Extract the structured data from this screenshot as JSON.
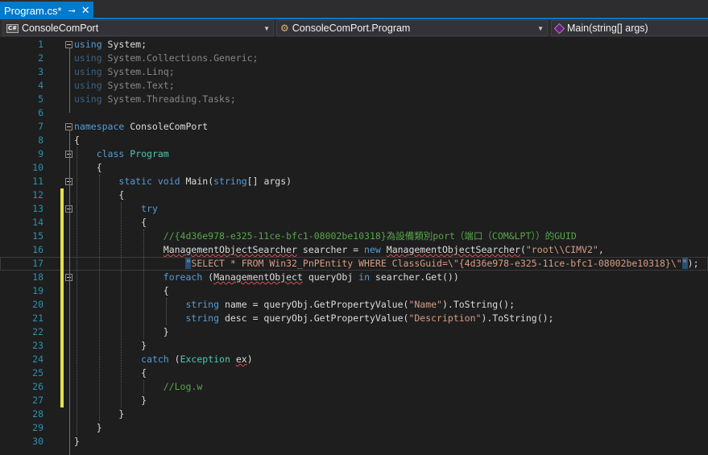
{
  "tab": {
    "title": "Program.cs*",
    "pin_icon": "pin-icon",
    "close_icon": "close-icon"
  },
  "navbar": {
    "project": "ConsoleComPort",
    "class_name": "ConsoleComPort.Program",
    "member": "Main(string[] args)"
  },
  "editor": {
    "colors": {
      "keyword": "#569cd6",
      "type": "#4ec9b0",
      "string": "#d69d85",
      "comment": "#57a64a",
      "line_number": "#2b91af",
      "changed": "#e5e04a"
    },
    "lines": [
      {
        "n": "1",
        "fold": true,
        "changed": false,
        "t": [
          [
            "kw",
            "using"
          ],
          [
            "txt",
            " System;"
          ]
        ]
      },
      {
        "n": "2",
        "fold": false,
        "changed": false,
        "t": [
          [
            "kw dim",
            "using"
          ],
          [
            "txt dim",
            " System.Collections.Generic;"
          ]
        ]
      },
      {
        "n": "3",
        "fold": false,
        "changed": false,
        "t": [
          [
            "kw dim",
            "using"
          ],
          [
            "txt dim",
            " System.Linq;"
          ]
        ]
      },
      {
        "n": "4",
        "fold": false,
        "changed": false,
        "t": [
          [
            "kw dim",
            "using"
          ],
          [
            "txt dim",
            " System.Text;"
          ]
        ]
      },
      {
        "n": "5",
        "fold": false,
        "changed": false,
        "t": [
          [
            "kw dim",
            "using"
          ],
          [
            "txt dim",
            " System.Threading.Tasks;"
          ]
        ]
      },
      {
        "n": "6",
        "fold": false,
        "changed": false,
        "t": []
      },
      {
        "n": "7",
        "fold": true,
        "changed": false,
        "t": [
          [
            "kw",
            "namespace"
          ],
          [
            "txt",
            " ConsoleComPort"
          ]
        ]
      },
      {
        "n": "8",
        "fold": false,
        "changed": false,
        "t": [
          [
            "txt",
            "{"
          ]
        ]
      },
      {
        "n": "9",
        "fold": true,
        "changed": false,
        "t": [
          [
            "txt",
            "    "
          ],
          [
            "kw",
            "class"
          ],
          [
            "txt",
            " "
          ],
          [
            "type",
            "Program"
          ]
        ]
      },
      {
        "n": "10",
        "fold": false,
        "changed": false,
        "t": [
          [
            "txt",
            "    {"
          ]
        ]
      },
      {
        "n": "11",
        "fold": true,
        "changed": false,
        "t": [
          [
            "txt",
            "        "
          ],
          [
            "kw",
            "static"
          ],
          [
            "txt",
            " "
          ],
          [
            "kw",
            "void"
          ],
          [
            "txt",
            " Main("
          ],
          [
            "kw",
            "string"
          ],
          [
            "txt",
            "[] args)"
          ]
        ]
      },
      {
        "n": "12",
        "fold": false,
        "changed": true,
        "t": [
          [
            "txt",
            "        {"
          ]
        ]
      },
      {
        "n": "13",
        "fold": true,
        "changed": true,
        "t": [
          [
            "txt",
            "            "
          ],
          [
            "kw",
            "try"
          ]
        ]
      },
      {
        "n": "14",
        "fold": false,
        "changed": true,
        "t": [
          [
            "txt",
            "            {"
          ]
        ]
      },
      {
        "n": "15",
        "fold": false,
        "changed": true,
        "t": [
          [
            "txt",
            "                "
          ],
          [
            "com",
            "//{4d36e978-e325-11ce-bfc1-08002be10318}為設備類別port（端口（COM&LPT））的GUID"
          ]
        ]
      },
      {
        "n": "16",
        "fold": false,
        "changed": true,
        "t": [
          [
            "txt",
            "                "
          ],
          [
            "err",
            "ManagementObjectSearcher"
          ],
          [
            "txt",
            " searcher = "
          ],
          [
            "kw",
            "new"
          ],
          [
            "txt",
            " "
          ],
          [
            "err",
            "ManagementObjectSearcher"
          ],
          [
            "txt",
            "("
          ],
          [
            "str",
            "\"root\\\\CIMV2\""
          ],
          [
            "txt",
            ","
          ]
        ]
      },
      {
        "n": "17",
        "fold": false,
        "changed": true,
        "t": [
          [
            "txt",
            "                    "
          ],
          [
            "str hl",
            "\""
          ],
          [
            "str",
            "SELECT * FROM Win32_PnPEntity WHERE ClassGuid=\\\"{4d36e978-e325-11ce-bfc1-08002be10318}\\\""
          ],
          [
            "str hl",
            "\""
          ],
          [
            "txt",
            ");"
          ]
        ]
      },
      {
        "n": "18",
        "fold": true,
        "changed": true,
        "t": [
          [
            "txt",
            "                "
          ],
          [
            "kw",
            "foreach"
          ],
          [
            "txt",
            " ("
          ],
          [
            "err",
            "ManagementObject"
          ],
          [
            "txt",
            " queryObj "
          ],
          [
            "kw",
            "in"
          ],
          [
            "txt",
            " searcher.Get())"
          ]
        ]
      },
      {
        "n": "19",
        "fold": false,
        "changed": true,
        "t": [
          [
            "txt",
            "                {"
          ]
        ]
      },
      {
        "n": "20",
        "fold": false,
        "changed": true,
        "t": [
          [
            "txt",
            "                    "
          ],
          [
            "kw",
            "string"
          ],
          [
            "txt",
            " name = queryObj.GetPropertyValue("
          ],
          [
            "str",
            "\"Name\""
          ],
          [
            "txt",
            ").ToString();"
          ]
        ]
      },
      {
        "n": "21",
        "fold": false,
        "changed": true,
        "t": [
          [
            "txt",
            "                    "
          ],
          [
            "kw",
            "string"
          ],
          [
            "txt",
            " desc = queryObj.GetPropertyValue("
          ],
          [
            "str",
            "\"Description\""
          ],
          [
            "txt",
            ").ToString();"
          ]
        ]
      },
      {
        "n": "22",
        "fold": false,
        "changed": true,
        "t": [
          [
            "txt",
            "                }"
          ]
        ]
      },
      {
        "n": "23",
        "fold": false,
        "changed": true,
        "t": [
          [
            "txt",
            "            }"
          ]
        ]
      },
      {
        "n": "24",
        "fold": false,
        "changed": true,
        "t": [
          [
            "txt",
            "            "
          ],
          [
            "kw",
            "catch"
          ],
          [
            "txt",
            " ("
          ],
          [
            "type",
            "Exception"
          ],
          [
            "txt",
            " "
          ],
          [
            "err",
            "ex"
          ],
          [
            "txt",
            ")"
          ]
        ]
      },
      {
        "n": "25",
        "fold": false,
        "changed": true,
        "t": [
          [
            "txt",
            "            {"
          ]
        ]
      },
      {
        "n": "26",
        "fold": false,
        "changed": true,
        "t": [
          [
            "txt",
            "                "
          ],
          [
            "com",
            "//Log.w"
          ]
        ]
      },
      {
        "n": "27",
        "fold": false,
        "changed": true,
        "t": [
          [
            "txt",
            "            }"
          ]
        ]
      },
      {
        "n": "28",
        "fold": false,
        "changed": false,
        "t": [
          [
            "txt",
            "        }"
          ]
        ]
      },
      {
        "n": "29",
        "fold": false,
        "changed": false,
        "t": [
          [
            "txt",
            "    }"
          ]
        ]
      },
      {
        "n": "30",
        "fold": false,
        "changed": false,
        "t": [
          [
            "txt",
            "}"
          ]
        ]
      }
    ]
  }
}
